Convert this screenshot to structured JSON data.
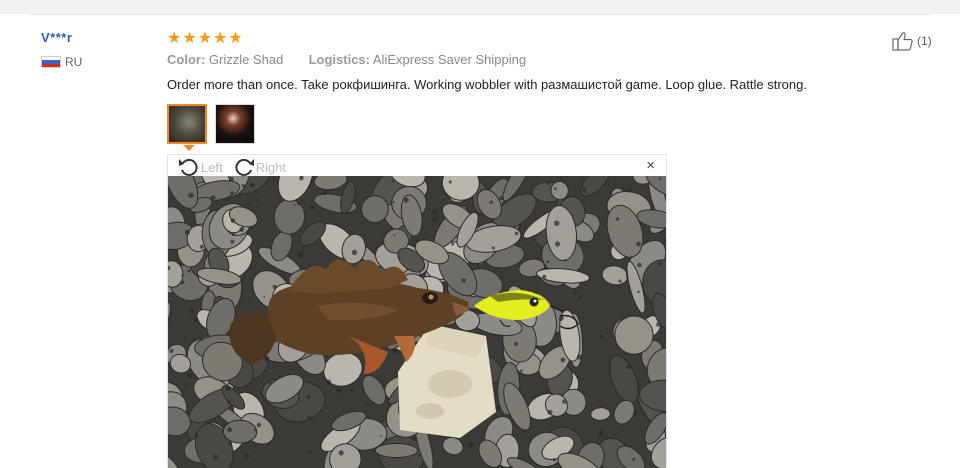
{
  "review": {
    "user_name": "V***r",
    "country": "RU",
    "rating": 5,
    "color_label": "Color:",
    "color_value": "Grizzle Shad",
    "logistics_label": "Logistics:",
    "logistics_value": "AliExpress Saver Shipping",
    "text": "Order more than once. Take рокфишинга. Working wobbler with размашистой game. Loop glue. Rattle strong.",
    "helpful_count": "(1)"
  },
  "viewer": {
    "rotate_left_label": "Left",
    "rotate_right_label": "Right",
    "close_label": "×"
  },
  "icons": {
    "star": "star-icon",
    "thumbs_up": "thumbs-up-icon",
    "rotate_left": "rotate-left-icon",
    "rotate_right": "rotate-right-icon",
    "close": "close-icon",
    "flag": "russia-flag-icon"
  },
  "colors": {
    "username": "#2f5cb7",
    "star": "#f39a15",
    "selected_thumbnail_border": "#f08a24"
  }
}
